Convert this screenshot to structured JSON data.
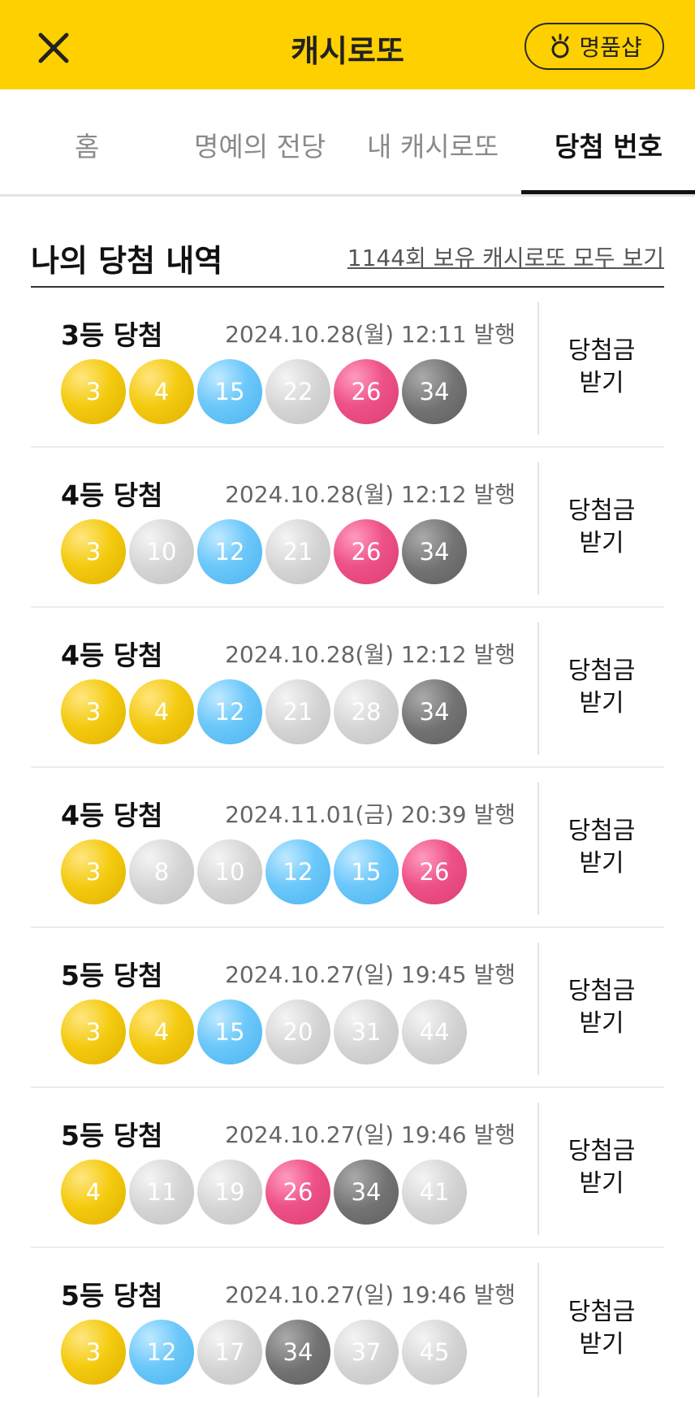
{
  "header": {
    "title": "캐시로또",
    "shop_label": "명품샵",
    "colors": {
      "bar": "#FFD000"
    }
  },
  "tabs": [
    {
      "label": "홈",
      "active": false
    },
    {
      "label": "명예의 전당",
      "active": false
    },
    {
      "label": "내 캐시로또",
      "active": false
    },
    {
      "label": "당첨 번호",
      "active": true
    }
  ],
  "section": {
    "title": "나의 당첨 내역",
    "see_all_link": "1144회 보유 캐시로또 모두 보기"
  },
  "entries": [
    {
      "rank": "3등 당첨",
      "issued": "2024.10.28(월) 12:11 발행",
      "balls": [
        {
          "n": "3",
          "c": "yellow"
        },
        {
          "n": "4",
          "c": "yellow"
        },
        {
          "n": "15",
          "c": "blue"
        },
        {
          "n": "22",
          "c": "gray"
        },
        {
          "n": "26",
          "c": "pink"
        },
        {
          "n": "34",
          "c": "dark"
        }
      ],
      "claim": "당첨금 받기"
    },
    {
      "rank": "4등 당첨",
      "issued": "2024.10.28(월) 12:12 발행",
      "balls": [
        {
          "n": "3",
          "c": "yellow"
        },
        {
          "n": "10",
          "c": "gray"
        },
        {
          "n": "12",
          "c": "blue"
        },
        {
          "n": "21",
          "c": "gray"
        },
        {
          "n": "26",
          "c": "pink"
        },
        {
          "n": "34",
          "c": "dark"
        }
      ],
      "claim": "당첨금 받기"
    },
    {
      "rank": "4등 당첨",
      "issued": "2024.10.28(월) 12:12 발행",
      "balls": [
        {
          "n": "3",
          "c": "yellow"
        },
        {
          "n": "4",
          "c": "yellow"
        },
        {
          "n": "12",
          "c": "blue"
        },
        {
          "n": "21",
          "c": "gray"
        },
        {
          "n": "28",
          "c": "gray"
        },
        {
          "n": "34",
          "c": "dark"
        }
      ],
      "claim": "당첨금 받기"
    },
    {
      "rank": "4등 당첨",
      "issued": "2024.11.01(금) 20:39 발행",
      "balls": [
        {
          "n": "3",
          "c": "yellow"
        },
        {
          "n": "8",
          "c": "gray"
        },
        {
          "n": "10",
          "c": "gray"
        },
        {
          "n": "12",
          "c": "blue"
        },
        {
          "n": "15",
          "c": "blue"
        },
        {
          "n": "26",
          "c": "pink"
        }
      ],
      "claim": "당첨금 받기"
    },
    {
      "rank": "5등 당첨",
      "issued": "2024.10.27(일) 19:45 발행",
      "balls": [
        {
          "n": "3",
          "c": "yellow"
        },
        {
          "n": "4",
          "c": "yellow"
        },
        {
          "n": "15",
          "c": "blue"
        },
        {
          "n": "20",
          "c": "gray"
        },
        {
          "n": "31",
          "c": "gray"
        },
        {
          "n": "44",
          "c": "gray"
        }
      ],
      "claim": "당첨금 받기"
    },
    {
      "rank": "5등 당첨",
      "issued": "2024.10.27(일) 19:46 발행",
      "balls": [
        {
          "n": "4",
          "c": "yellow"
        },
        {
          "n": "11",
          "c": "gray"
        },
        {
          "n": "19",
          "c": "gray"
        },
        {
          "n": "26",
          "c": "pink"
        },
        {
          "n": "34",
          "c": "dark"
        },
        {
          "n": "41",
          "c": "gray"
        }
      ],
      "claim": "당첨금 받기"
    },
    {
      "rank": "5등 당첨",
      "issued": "2024.10.27(일) 19:46 발행",
      "balls": [
        {
          "n": "3",
          "c": "yellow"
        },
        {
          "n": "12",
          "c": "blue"
        },
        {
          "n": "17",
          "c": "gray"
        },
        {
          "n": "34",
          "c": "dark"
        },
        {
          "n": "37",
          "c": "gray"
        },
        {
          "n": "45",
          "c": "gray"
        }
      ],
      "claim": "당첨금 받기"
    }
  ]
}
